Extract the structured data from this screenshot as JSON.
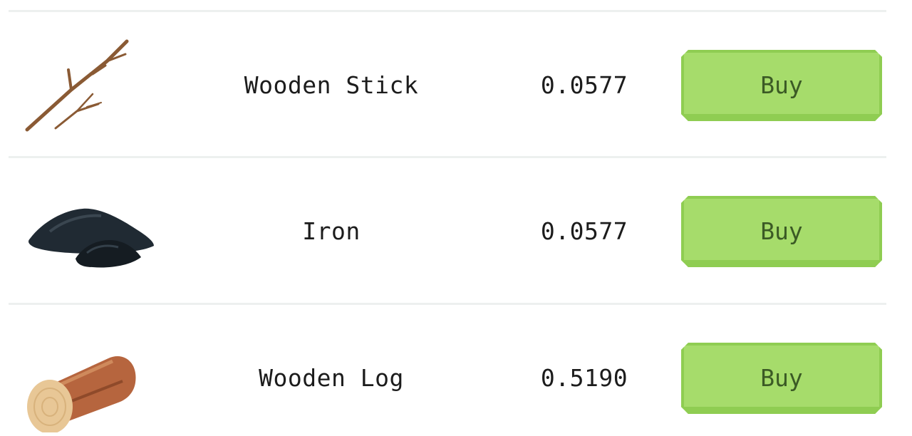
{
  "shop": {
    "items": [
      {
        "name": "Wooden Stick",
        "price": "0.0577",
        "buy_label": "Buy",
        "icon": "wooden-stick-icon"
      },
      {
        "name": "Iron",
        "price": "0.0577",
        "buy_label": "Buy",
        "icon": "iron-ore-icon"
      },
      {
        "name": "Wooden Log",
        "price": "0.5190",
        "buy_label": "Buy",
        "icon": "wooden-log-icon"
      }
    ]
  },
  "colors": {
    "buy_button_fill": "#a6dc6b",
    "buy_button_edge": "#8fcd52",
    "buy_label_text": "#3b5a25",
    "divider": "#edf0ef"
  }
}
